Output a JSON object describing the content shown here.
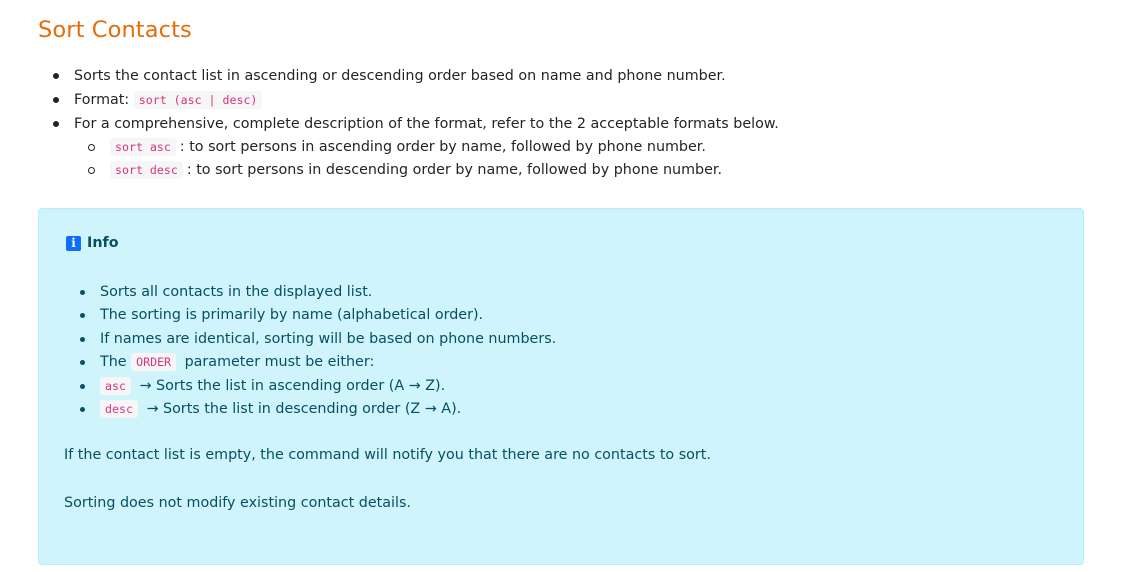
{
  "section": {
    "title": "Sort Contacts"
  },
  "main_list": {
    "item1": "Sorts the contact list in ascending or descending order based on name and phone number.",
    "item2_prefix": "Format: ",
    "item2_code": "sort (asc | desc)",
    "item3": "For a comprehensive, complete description of the format, refer to the 2 acceptable formats below.",
    "sub_items": [
      {
        "code": "sort asc",
        "text": ": to sort persons in ascending order by name, followed by phone number."
      },
      {
        "code": "sort desc",
        "text": ": to sort persons in descending order by name, followed by phone number."
      }
    ]
  },
  "info": {
    "icon": "info-icon",
    "heading": "Info",
    "items": {
      "i1": "Sorts all contacts in the displayed list.",
      "i2": "The sorting is primarily by name (alphabetical order).",
      "i3": "If names are identical, sorting will be based on phone numbers.",
      "i4_prefix": "The ",
      "i4_code": "ORDER",
      "i4_suffix": " parameter must be either:",
      "i5_code": "asc",
      "i5_text": " → Sorts the list in ascending order (A → Z).",
      "i6_code": "desc",
      "i6_text": " → Sorts the list in descending order (Z → A)."
    },
    "para1": "If the contact list is empty, the command will notify you that there are no contacts to sort.",
    "para2": "Sorting does not modify existing contact details."
  },
  "colors": {
    "title": "#e46c0a",
    "code_text": "#d63384",
    "info_bg": "#cff4fc",
    "info_text": "#055160",
    "info_icon_bg": "#0d6efd"
  }
}
